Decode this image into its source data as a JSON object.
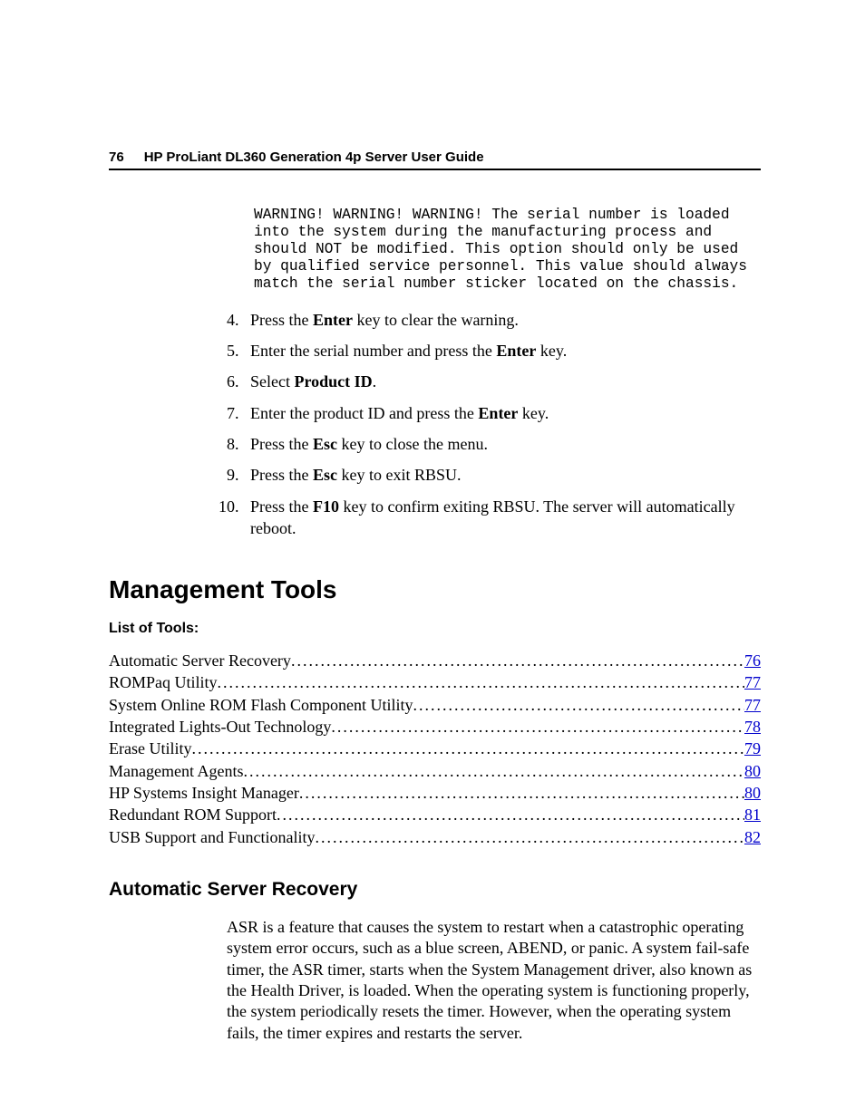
{
  "header": {
    "page_number": "76",
    "title": "HP ProLiant DL360 Generation 4p Server User Guide"
  },
  "warning_text": "WARNING! WARNING! WARNING! The serial number is loaded into the system during the manufacturing process and should NOT be modified. This option should only be used by qualified service personnel. This value should always match the serial number sticker located on the chassis.",
  "steps": {
    "s4_a": "Press the ",
    "s4_b": "Enter",
    "s4_c": " key to clear the warning.",
    "s5_a": "Enter the serial number and press the ",
    "s5_b": "Enter",
    "s5_c": " key.",
    "s6_a": "Select ",
    "s6_b": "Product ID",
    "s6_c": ".",
    "s7_a": "Enter the product ID and press the ",
    "s7_b": "Enter",
    "s7_c": " key.",
    "s8_a": "Press the ",
    "s8_b": "Esc",
    "s8_c": " key to close the menu.",
    "s9_a": "Press the ",
    "s9_b": "Esc",
    "s9_c": " key to exit RBSU.",
    "s10_a": "Press the ",
    "s10_b": "F10",
    "s10_c": " key to confirm exiting RBSU. The server will automatically reboot."
  },
  "section_heading": "Management Tools",
  "list_label": "List of Tools:",
  "toc": [
    {
      "title": "Automatic Server Recovery",
      "page": "76"
    },
    {
      "title": "ROMPaq Utility",
      "page": "77"
    },
    {
      "title": "System Online ROM Flash Component Utility",
      "page": "77"
    },
    {
      "title": "Integrated Lights-Out Technology ",
      "page": "78"
    },
    {
      "title": "Erase Utility",
      "page": "79"
    },
    {
      "title": "Management Agents",
      "page": "80"
    },
    {
      "title": "HP Systems Insight Manager ",
      "page": "80"
    },
    {
      "title": "Redundant ROM Support",
      "page": "81"
    },
    {
      "title": "USB Support and Functionality",
      "page": "82"
    }
  ],
  "subsection_heading": "Automatic Server Recovery",
  "body_paragraph": "ASR is a feature that causes the system to restart when a catastrophic operating system error occurs, such as a blue screen, ABEND, or panic. A system fail-safe timer, the ASR timer, starts when the System Management driver, also known as the Health Driver, is loaded. When the operating system is functioning properly, the system periodically resets the timer. However, when the operating system fails, the timer expires and restarts the server."
}
